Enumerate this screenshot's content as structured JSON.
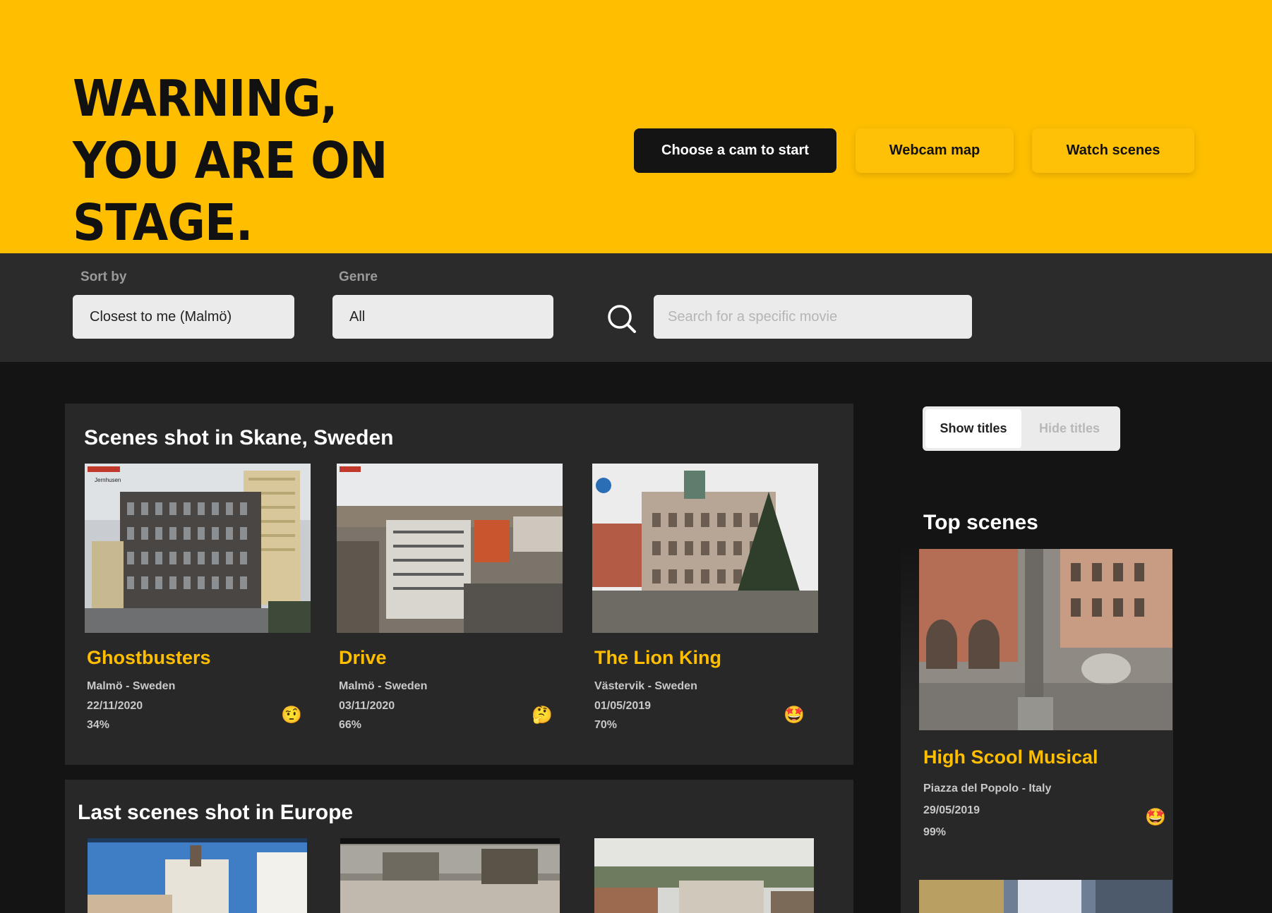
{
  "hero": {
    "title_line1": "WARNING,",
    "title_line2": "YOU ARE ON STAGE.",
    "btn_choose": "Choose a cam to start",
    "btn_map": "Webcam map",
    "btn_watch": "Watch scenes",
    "accent": "#ffbf00"
  },
  "filters": {
    "sort_label": "Sort by",
    "sort_value": "Closest to me (Malmö)",
    "genre_label": "Genre",
    "genre_value": "All",
    "search_placeholder": "Search for a specific movie"
  },
  "skane": {
    "title": "Scenes shot in Skane, Sweden",
    "scenes": [
      {
        "title": "Ghostbusters",
        "location": "Malmö - Sweden",
        "date": "22/11/2020",
        "score": "34%",
        "emoji": "🤨",
        "overlay": "Jernhusen"
      },
      {
        "title": "Drive",
        "location": "Malmö - Sweden",
        "date": "03/11/2020",
        "score": "66%",
        "emoji": "🤔",
        "overlay": ""
      },
      {
        "title": "The Lion King",
        "location": "Västervik - Sweden",
        "date": "01/05/2019",
        "score": "70%",
        "emoji": "🤩",
        "overlay": ""
      }
    ]
  },
  "europe": {
    "title": "Last scenes shot in Europe"
  },
  "sidebar": {
    "show_titles": "Show titles",
    "hide_titles": "Hide titles",
    "top_title": "Top scenes",
    "top_scene": {
      "title": "High Scool Musical",
      "location": "Piazza del Popolo - Italy",
      "date": "29/05/2019",
      "score": "99%",
      "emoji": "🤩"
    }
  },
  "icons": {
    "search": "search-icon"
  }
}
